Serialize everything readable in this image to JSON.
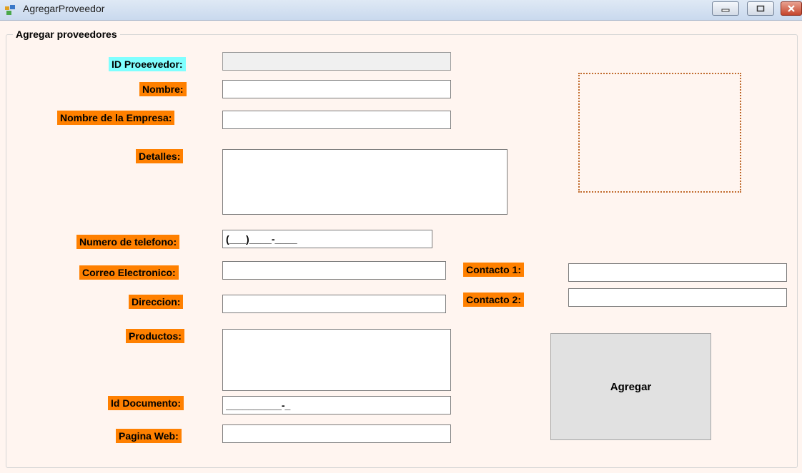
{
  "window": {
    "title": "AgregarProveedor",
    "icon": "app-form-icon",
    "controls": [
      "minimize-icon",
      "maximize-icon",
      "close-icon"
    ]
  },
  "group": {
    "title": "Agregar proveedores"
  },
  "labels": {
    "id": "ID Proeevedor:",
    "nombre": "Nombre:",
    "empresa": "Nombre de la Empresa:",
    "detalles": "Detalles:",
    "telefono": "Numero de telefono:",
    "correo": "Correo Electronico:",
    "direccion": "Direccion:",
    "productos": "Productos:",
    "documento": "Id Documento:",
    "web": "Pagina Web:",
    "contacto1": "Contacto 1:",
    "contacto2": "Contacto 2:"
  },
  "fields": {
    "id": "",
    "nombre": "",
    "empresa": "",
    "detalles": "",
    "telefono_mask": "(___)____-____",
    "correo": "",
    "direccion": "",
    "productos": "",
    "documento_mask": "__________-_",
    "web": "",
    "contacto1": "",
    "contacto2": ""
  },
  "buttons": {
    "agregar": "Agregar"
  },
  "colors": {
    "label_bg": "#ff8000",
    "id_label_bg": "#80ffff",
    "form_bg": "#fff5f0",
    "picture_border": "#c06a2c"
  }
}
